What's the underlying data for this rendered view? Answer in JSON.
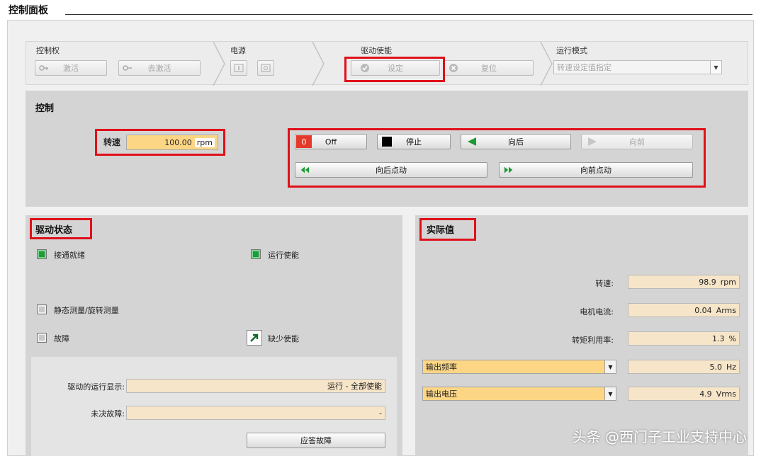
{
  "window": {
    "title": "控制面板"
  },
  "toolbar": {
    "control_right": {
      "label": "控制权",
      "activate": "激活",
      "deactivate": "去激活"
    },
    "power": {
      "label": "电源"
    },
    "drive_enable": {
      "label": "驱动使能",
      "set": "设定",
      "reset": "复位"
    },
    "run_mode": {
      "label": "运行模式",
      "selected": "转速设定值指定"
    }
  },
  "control": {
    "heading": "控制",
    "speed": {
      "label": "转速",
      "value": "100.00",
      "unit": "rpm"
    },
    "buttons": {
      "off_indicator": "0",
      "off": "Off",
      "stop": "停止",
      "backward": "向后",
      "forward": "向前",
      "jog_backward": "向后点动",
      "jog_forward": "向前点动"
    }
  },
  "drive_status": {
    "heading": "驱动状态",
    "items": {
      "ready": "接通就绪",
      "run_enable": "运行使能",
      "measure": "静态测量/旋转测量",
      "fault": "故障",
      "missing_enable": "缺少使能"
    },
    "run_display": {
      "label": "驱动的运行显示:",
      "value": "运行 - 全部使能"
    },
    "pending_fault": {
      "label": "未决故障:",
      "value": "-"
    },
    "ack_button": "应答故障"
  },
  "actual_values": {
    "heading": "实际值",
    "rows": [
      {
        "label": "转速:",
        "value": "98.9",
        "unit": "rpm"
      },
      {
        "label": "电机电流:",
        "value": "0.04",
        "unit": "Arms"
      },
      {
        "label": "转矩利用率:",
        "value": "1.3",
        "unit": "%"
      }
    ],
    "selectable": [
      {
        "option": "输出频率",
        "value": "5.0",
        "unit": "Hz"
      },
      {
        "option": "输出电压",
        "value": "4.9",
        "unit": "Vrms"
      }
    ]
  },
  "watermark": "头条 @西门子工业支持中心",
  "colors": {
    "highlight_red": "#e0101a",
    "field_orange": "#fcd685",
    "field_beige": "#f6e5c9",
    "led_green": "#1f9a3c"
  }
}
